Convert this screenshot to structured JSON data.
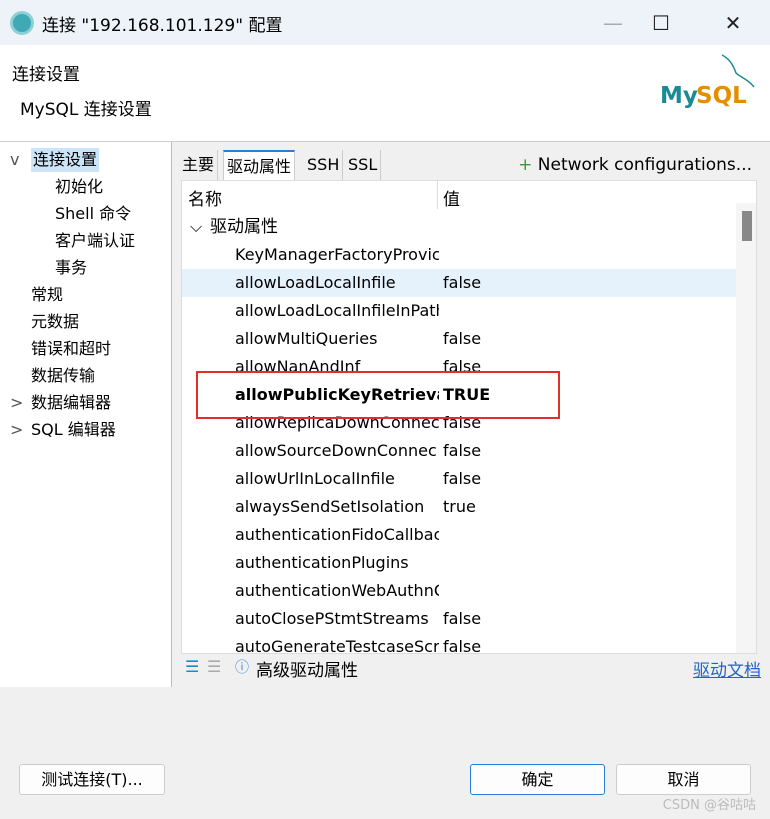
{
  "window": {
    "title": "连接 \"192.168.101.129\" 配置",
    "min": "—",
    "max": "☐",
    "close": "✕"
  },
  "header": {
    "title": "连接设置",
    "subtitle": "MySQL 连接设置",
    "logo_text": "MySQL"
  },
  "tree": [
    {
      "label": "连接设置",
      "expander": "v",
      "selected": true
    },
    {
      "label": "初始化"
    },
    {
      "label": "Shell 命令"
    },
    {
      "label": "客户端认证"
    },
    {
      "label": "事务"
    },
    {
      "label": "常规"
    },
    {
      "label": "元数据"
    },
    {
      "label": "错误和超时"
    },
    {
      "label": "数据传输"
    },
    {
      "label": "数据编辑器",
      "expander": ">"
    },
    {
      "label": "SQL 编辑器",
      "expander": ">"
    }
  ],
  "tabs": [
    "主要",
    "驱动属性",
    "SSH",
    "SSL"
  ],
  "active_tab": "驱动属性",
  "network_config": "Network configurations...",
  "table": {
    "headers": [
      "名称",
      "值"
    ],
    "group": "驱动属性",
    "rows": [
      {
        "name": "KeyManagerFactoryProvic",
        "value": ""
      },
      {
        "name": "allowLoadLocalInfile",
        "value": "false"
      },
      {
        "name": "allowLoadLocalInfileInPath",
        "value": ""
      },
      {
        "name": "allowMultiQueries",
        "value": "false"
      },
      {
        "name": "allowNanAndInf",
        "value": "false"
      },
      {
        "name": "allowPublicKeyRetrieval",
        "value": "TRUE"
      },
      {
        "name": "allowReplicaDownConnec",
        "value": "false"
      },
      {
        "name": "allowSourceDownConnec",
        "value": "false"
      },
      {
        "name": "allowUrlInLocalInfile",
        "value": "false"
      },
      {
        "name": "alwaysSendSetIsolation",
        "value": "true"
      },
      {
        "name": "authenticationFidoCallbac",
        "value": ""
      },
      {
        "name": "authenticationPlugins",
        "value": ""
      },
      {
        "name": "authenticationWebAuthnC",
        "value": ""
      },
      {
        "name": "autoClosePStmtStreams",
        "value": "false"
      },
      {
        "name": "autoGenerateTestcaseScript",
        "value": "false"
      }
    ]
  },
  "toolbar": {
    "advanced": "高级驱动属性",
    "docs": "驱动文档"
  },
  "buttons": {
    "test": "测试连接(T)...",
    "ok": "确定",
    "cancel": "取消"
  },
  "watermark": "CSDN @谷咕咕",
  "colors": {
    "highlight": "#e0302b",
    "accent": "#2a7fd4",
    "link": "#1a66c9"
  }
}
